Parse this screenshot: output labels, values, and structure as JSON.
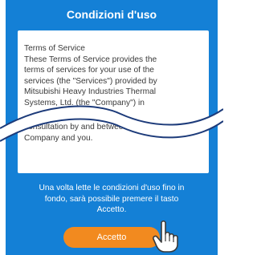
{
  "header": {
    "title": "Condizioni d'uso"
  },
  "terms": {
    "top_text": "Terms of Service\nThese Terms of Service provides the\nterms of services for your use of the\nservices (the \"Services\") provided by\nMitsubishi Heavy Industries Thermal\nSystems, Ltd. (the \"Company\") in",
    "bottom_text": "consultation by and between the\nCompany and you."
  },
  "instruction": {
    "text": "Una volta lette le condizioni d'uso fino in fondo, sarà possibile premere il tasto Accetto."
  },
  "accept_button": {
    "label": "Accetto"
  },
  "icons": {
    "hand": "pointing-hand-icon"
  },
  "colors": {
    "background": "#1480d6",
    "accent": "#f28a1f",
    "panel": "#ffffff"
  }
}
